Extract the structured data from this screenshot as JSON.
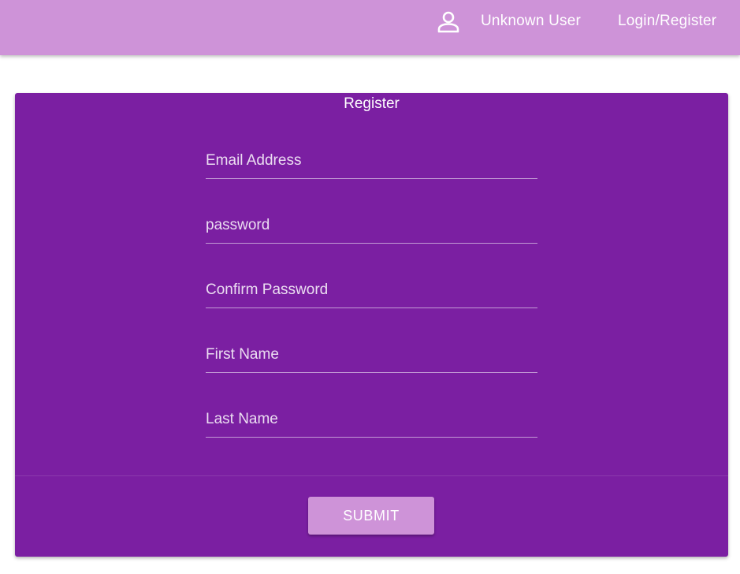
{
  "header": {
    "user_icon": "person-icon",
    "user_name": "Unknown User",
    "login_link": "Login/Register"
  },
  "form": {
    "title": "Register",
    "fields": [
      {
        "placeholder": "Email Address",
        "value": ""
      },
      {
        "placeholder": "password",
        "value": ""
      },
      {
        "placeholder": "Confirm Password",
        "value": ""
      },
      {
        "placeholder": "First Name",
        "value": ""
      },
      {
        "placeholder": "Last Name",
        "value": ""
      }
    ],
    "submit_label": "SUBMIT"
  },
  "colors": {
    "header_bg": "#ce93d8",
    "card_bg": "#7b1fa2",
    "button_bg": "#ce93d8",
    "text": "#ffffff"
  }
}
